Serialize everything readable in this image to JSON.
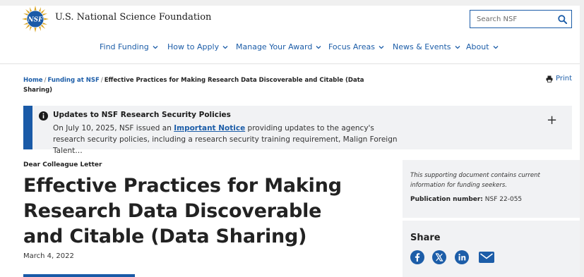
{
  "header": {
    "org_name": "U.S. National Science Foundation",
    "logo_text": "NSF",
    "search_placeholder": "Search NSF"
  },
  "nav": {
    "items": [
      {
        "label": "Find Funding"
      },
      {
        "label": "How to Apply"
      },
      {
        "label": "Manage Your Award"
      },
      {
        "label": "Focus Areas"
      },
      {
        "label": "News & Events"
      },
      {
        "label": "About"
      }
    ]
  },
  "breadcrumb": {
    "home": "Home",
    "funding": "Funding at NSF",
    "current": "Effective Practices for Making Research Data Discoverable and Citable (Data Sharing)",
    "separator": "/"
  },
  "print_label": "Print",
  "alert": {
    "title": "Updates to NSF Research Security Policies",
    "text_before": "On July 10, 2025, NSF issued an ",
    "link_text": "Important Notice",
    "text_after": " providing updates to the agency's research security policies, including a research security training requirement, Malign Foreign Talent…",
    "expand_symbol": "+"
  },
  "document": {
    "type": "Dear Colleague Letter",
    "title": "Effective Practices for Making Research Data Discoverable and Citable (Data Sharing)",
    "date": "March 4, 2022"
  },
  "sidebar": {
    "note": "This supporting document contains current information for funding seekers.",
    "pub_label": "Publication number:",
    "pub_value": " NSF 22-055",
    "share_title": "Share",
    "share_icons": [
      "facebook-icon",
      "x-icon",
      "linkedin-icon",
      "email-icon"
    ]
  },
  "colors": {
    "link_blue": "#1c5da8",
    "accent_blue": "#1a5aa7",
    "panel_gray": "#f1f2f4"
  }
}
